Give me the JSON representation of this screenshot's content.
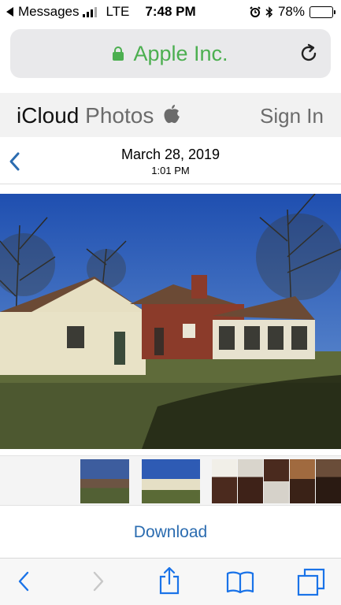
{
  "status_bar": {
    "back_app": "Messages",
    "network": "LTE",
    "time": "7:48 PM",
    "battery_percent": "78%",
    "battery_level": 0.78,
    "icons": [
      "back-triangle-icon",
      "signal-bars-icon",
      "alarm-icon",
      "bluetooth-icon",
      "battery-icon"
    ]
  },
  "browser": {
    "site_name": "Apple Inc.",
    "icons": [
      "lock-icon",
      "reload-icon"
    ]
  },
  "header": {
    "brand_primary": "iCloud",
    "brand_secondary": "Photos",
    "sign_in_label": "Sign In",
    "icons": [
      "apple-logo-icon"
    ]
  },
  "photo_view": {
    "date": "March 28, 2019",
    "time": "1:01 PM",
    "icons": [
      "back-chevron-icon"
    ]
  },
  "thumbnails": {
    "count": 8,
    "selected_index": 2
  },
  "actions": {
    "download_label": "Download"
  },
  "toolbar": {
    "icons": [
      "back-arrow-icon",
      "forward-arrow-icon",
      "share-icon",
      "bookmarks-icon",
      "tabs-icon"
    ]
  },
  "colors": {
    "secure_green": "#4caf50",
    "link_blue": "#2b6cb0",
    "toolbar_blue": "#1a73e8"
  }
}
